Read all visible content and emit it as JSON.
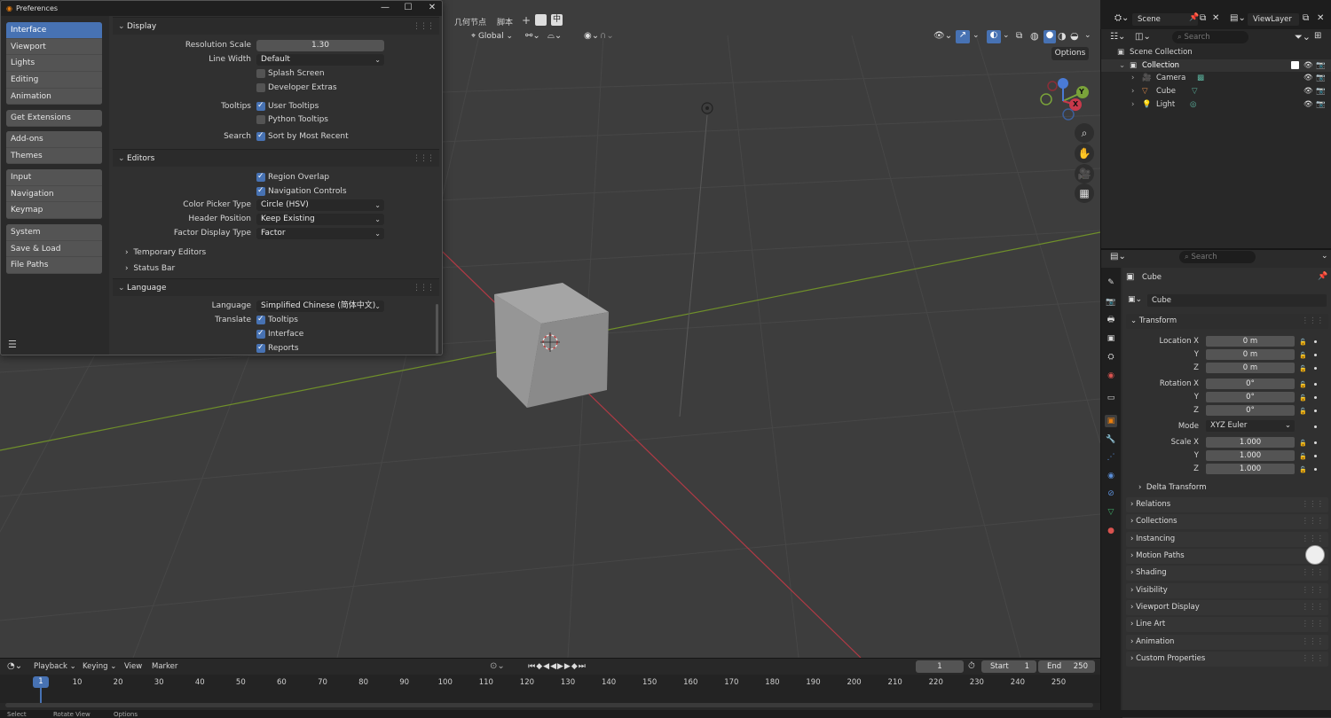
{
  "viewport_header": {
    "menu_items": [
      "几何节点",
      "脚本",
      "+"
    ],
    "ime_label": "中",
    "transform_orientation": "Global",
    "options_label": "Options"
  },
  "gizmo": {
    "y": "Y",
    "x": "X",
    "z": "Z"
  },
  "preferences": {
    "title": "Preferences",
    "sidebar_groups": [
      [
        "Interface",
        "Viewport",
        "Lights",
        "Editing",
        "Animation"
      ],
      [
        "Get Extensions"
      ],
      [
        "Add-ons",
        "Themes"
      ],
      [
        "Input",
        "Navigation",
        "Keymap"
      ],
      [
        "System",
        "Save & Load",
        "File Paths"
      ]
    ],
    "display": {
      "header": "Display",
      "resolution_scale_label": "Resolution Scale",
      "resolution_scale_value": "1.30",
      "line_width_label": "Line Width",
      "line_width_value": "Default",
      "splash_screen": "Splash Screen",
      "developer_extras": "Developer Extras",
      "tooltips_label": "Tooltips",
      "user_tooltips": "User Tooltips",
      "python_tooltips": "Python Tooltips",
      "search_label": "Search",
      "sort_recent": "Sort by Most Recent"
    },
    "editors": {
      "header": "Editors",
      "region_overlap": "Region Overlap",
      "navigation_controls": "Navigation Controls",
      "color_picker_label": "Color Picker Type",
      "color_picker_value": "Circle (HSV)",
      "header_position_label": "Header Position",
      "header_position_value": "Keep Existing",
      "factor_display_label": "Factor Display Type",
      "factor_display_value": "Factor",
      "temporary_editors": "Temporary Editors",
      "status_bar": "Status Bar"
    },
    "language": {
      "header": "Language",
      "language_label": "Language",
      "language_value": "Simplified Chinese (简体中文)",
      "translate_label": "Translate",
      "tooltips": "Tooltips",
      "interface": "Interface",
      "reports": "Reports"
    }
  },
  "topbar_right": {
    "scene": "Scene",
    "view_layer": "ViewLayer"
  },
  "outliner": {
    "search_placeholder": "Search",
    "scene_collection": "Scene Collection",
    "collection": "Collection",
    "items": [
      "Camera",
      "Cube",
      "Light"
    ]
  },
  "properties": {
    "search_placeholder": "Search",
    "object_name": "Cube",
    "object_field": "Cube",
    "transform_header": "Transform",
    "location_label": "Location X",
    "y_label": "Y",
    "z_label": "Z",
    "location": [
      "0 m",
      "0 m",
      "0 m"
    ],
    "rotation_label": "Rotation X",
    "rotation": [
      "0°",
      "0°",
      "0°"
    ],
    "mode_label": "Mode",
    "mode_value": "XYZ Euler",
    "scale_label": "Scale X",
    "scale": [
      "1.000",
      "1.000",
      "1.000"
    ],
    "delta_transform": "Delta Transform",
    "panels": [
      "Relations",
      "Collections",
      "Instancing",
      "Motion Paths",
      "Shading",
      "Visibility",
      "Viewport Display",
      "Line Art",
      "Animation",
      "Custom Properties"
    ]
  },
  "timeline": {
    "playback": "Playback",
    "keying": "Keying",
    "view": "View",
    "marker": "Marker",
    "current_frame": "1",
    "start_label": "Start",
    "start_value": "1",
    "end_label": "End",
    "end_value": "250",
    "frame_marker": "1",
    "frames": [
      "10",
      "20",
      "30",
      "40",
      "50",
      "60",
      "70",
      "80",
      "90",
      "100",
      "110",
      "120",
      "130",
      "140",
      "150",
      "160",
      "170",
      "180",
      "190",
      "200",
      "210",
      "220",
      "230",
      "240",
      "250"
    ]
  },
  "status_bar": [
    "Select",
    "Rotate View",
    "Options"
  ],
  "colors": {
    "accent": "#4772b3",
    "x_axis": "#c8394b",
    "y_axis": "#7a9a2e",
    "viewport_bg": "#3d3d3d"
  }
}
